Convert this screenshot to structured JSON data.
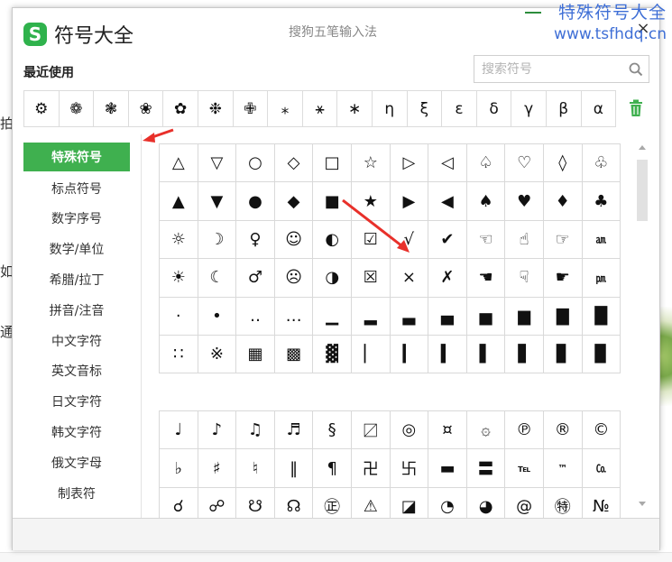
{
  "watermark": {
    "title": "特殊符号大全",
    "url": "www.tsfhdq.cn"
  },
  "background": {
    "left_fragments": [
      "拍",
      "如",
      "通"
    ]
  },
  "dialog": {
    "app_title": "符号大全",
    "subtitle": "搜狗五笔输入法",
    "close_label": "×",
    "recent_label": "最近使用",
    "search": {
      "placeholder": "搜索符号",
      "value": ""
    },
    "recent_symbols": [
      "⚙",
      "❁",
      "❃",
      "❀",
      "✿",
      "❉",
      "✙",
      "⁎",
      "⚹",
      "∗",
      "η",
      "ξ",
      "ε",
      "δ",
      "γ",
      "β",
      "α"
    ],
    "sidebar": [
      {
        "label": "特殊符号",
        "active": true
      },
      {
        "label": "标点符号"
      },
      {
        "label": "数字序号"
      },
      {
        "label": "数学/单位"
      },
      {
        "label": "希腊/拉丁"
      },
      {
        "label": "拼音/注音"
      },
      {
        "label": "中文字符"
      },
      {
        "label": "英文音标"
      },
      {
        "label": "日文字符"
      },
      {
        "label": "韩文字符"
      },
      {
        "label": "俄文字母"
      },
      {
        "label": "制表符"
      }
    ],
    "grid1": [
      [
        "△",
        "▽",
        "○",
        "◇",
        "□",
        "☆",
        "▷",
        "◁",
        "♤",
        "♡",
        "◊",
        "♧"
      ],
      [
        "▲",
        "▼",
        "●",
        "◆",
        "■",
        "★",
        "▶",
        "◀",
        "♠",
        "♥",
        "♦",
        "♣"
      ],
      [
        "☼",
        "☽",
        "♀",
        "☺",
        "◐",
        "☑",
        "√",
        "✔",
        "☜",
        "☝",
        "☞",
        "㏂"
      ],
      [
        "☀",
        "☾",
        "♂",
        "☹",
        "◑",
        "☒",
        "×",
        "✗",
        "☚",
        "☟",
        "☛",
        "㏘"
      ],
      [
        "·",
        "•",
        "‥",
        "…",
        "▁",
        "▂",
        "▃",
        "▄",
        "▅",
        "▆",
        "▇",
        "█"
      ],
      [
        "∷",
        "※",
        "▦",
        "▩",
        "▓",
        "▏",
        "▎",
        "▍",
        "▌",
        "▋",
        "▊",
        "▉"
      ]
    ],
    "grid2": [
      [
        "♩",
        "♪",
        "♫",
        "♬",
        "§",
        "〼",
        "◎",
        "¤",
        "۞",
        "℗",
        "®",
        "©"
      ],
      [
        "♭",
        "♯",
        "♮",
        "‖",
        "¶",
        "卍",
        "卐",
        "▬",
        "〓",
        "℡",
        "™",
        "㏇"
      ],
      [
        "☌",
        "☍",
        "☋",
        "☊",
        "㊣",
        "⚠",
        "◪",
        "◔",
        "◕",
        "@",
        "㊕",
        "№"
      ]
    ],
    "colors": {
      "accent": "#3fb04f",
      "watermark": "#3f6fd6",
      "annotation_arrow": "#e8302a"
    }
  }
}
